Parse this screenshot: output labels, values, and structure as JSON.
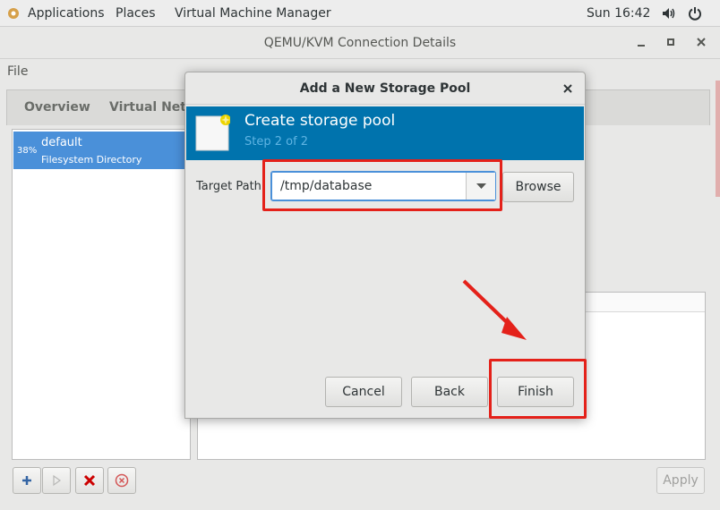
{
  "topbar": {
    "applications": "Applications",
    "places": "Places",
    "app_name": "Virtual Machine Manager",
    "clock": "Sun 16:42"
  },
  "window": {
    "title": "QEMU/KVM Connection Details",
    "file_menu": "File",
    "tabs": [
      "Overview",
      "Virtual Netw"
    ],
    "pool": {
      "percent": "38%",
      "name": "default",
      "type": "Filesystem Directory"
    },
    "apply_label": "Apply"
  },
  "dialog": {
    "title": "Add a New Storage Pool",
    "banner_title": "Create storage pool",
    "banner_step": "Step 2 of 2",
    "target_path_label": "Target Path:",
    "target_path_value": "/tmp/database",
    "browse_label": "Browse",
    "cancel_label": "Cancel",
    "back_label": "Back",
    "finish_label": "Finish"
  },
  "colors": {
    "banner": "#0073ad",
    "selection": "#4a90d9",
    "annotation": "#e4211a"
  }
}
